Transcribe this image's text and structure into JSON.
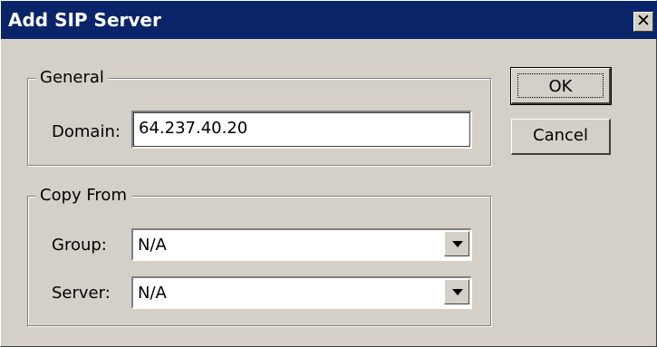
{
  "window": {
    "title": "Add SIP Server",
    "close_glyph": "✕"
  },
  "general": {
    "legend": "General",
    "domain_label": "Domain:",
    "domain_value": "64.237.40.20"
  },
  "copy_from": {
    "legend": "Copy From",
    "group_label": "Group:",
    "group_value": "N/A",
    "server_label": "Server:",
    "server_value": "N/A"
  },
  "buttons": {
    "ok": "OK",
    "cancel": "Cancel"
  },
  "colors": {
    "titlebar": "#0a246a",
    "face": "#d4d0c8"
  }
}
